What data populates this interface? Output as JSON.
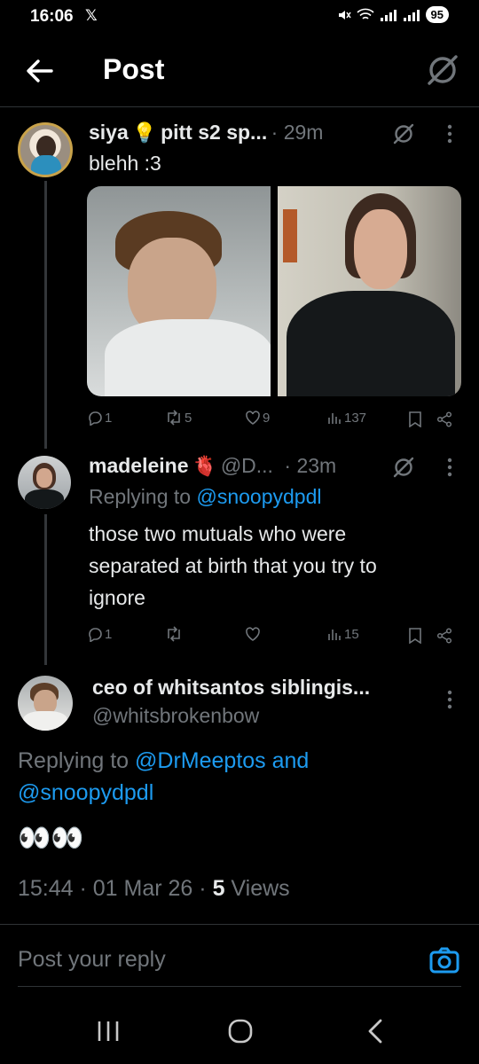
{
  "status": {
    "time": "16:06",
    "x_glyph": "𝕏",
    "battery": "95"
  },
  "header": {
    "title": "Post"
  },
  "post1": {
    "name": "siya",
    "name_rest": "pitt s2 sp...",
    "time": "· 29m",
    "text": "blehh :3",
    "actions": {
      "replies": "1",
      "reposts": "5",
      "likes": "9",
      "views": "137"
    }
  },
  "post2": {
    "name": "madeleine",
    "handle": "@D...",
    "time": "· 23m",
    "replying_prefix": "Replying to ",
    "replying_to": "@snoopydpdl",
    "text_lines": [
      "those two mutuals who were",
      "separated at birth that you try to",
      "ignore"
    ],
    "actions": {
      "replies": "1",
      "reposts": "",
      "likes": "",
      "views": "15"
    }
  },
  "main": {
    "name": "ceo of whitsantos siblingis...",
    "handle": "@whitsbrokenbow",
    "replying_prefix": "Replying to ",
    "replying_to_1": "@DrMeeptos and",
    "replying_to_2": "@snoopydpdl",
    "text": "👀👀",
    "timestamp": "15:44 · 01 Mar 26 · ",
    "views_count": "5",
    "views_label": " Views"
  },
  "reply_bar": {
    "placeholder": "Post your reply"
  },
  "colors": {
    "accent": "#1d9bf0",
    "muted": "#71767b",
    "text": "#e7e9ea",
    "bg": "#000000"
  }
}
